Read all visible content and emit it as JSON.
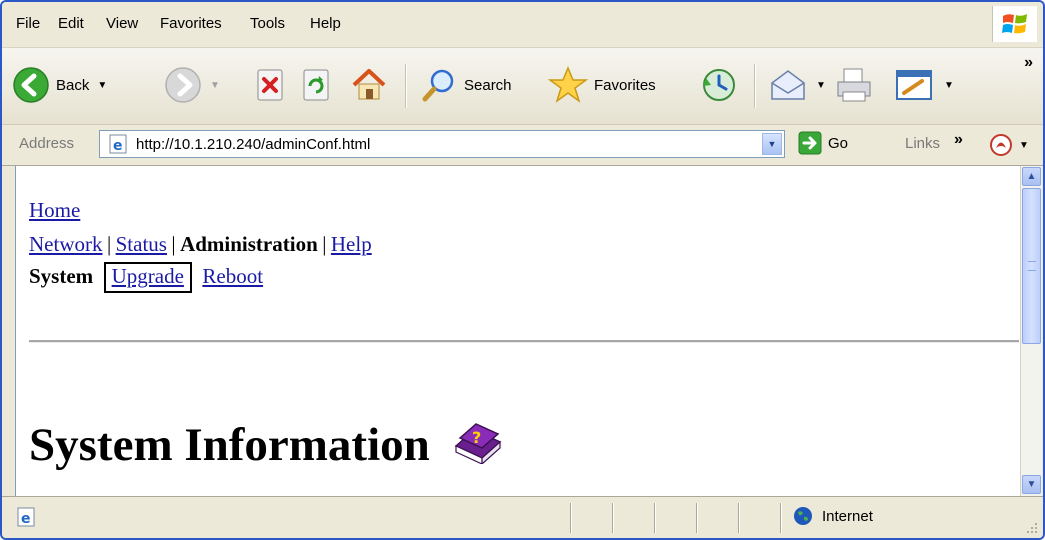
{
  "menu": {
    "items": [
      "File",
      "Edit",
      "View",
      "Favorites",
      "Tools",
      "Help"
    ]
  },
  "toolbar": {
    "back_label": "Back",
    "search_label": "Search",
    "favorites_label": "Favorites",
    "more_chevron": "»"
  },
  "address": {
    "label": "Address",
    "url": "http://10.1.210.240/adminConf.html",
    "go_label": "Go",
    "links_label": "Links",
    "links_chevron": "»"
  },
  "page": {
    "home": "Home",
    "nav": {
      "network": "Network",
      "status": "Status",
      "administration": "Administration",
      "help": "Help",
      "separator": "|"
    },
    "subnav": {
      "system": "System",
      "upgrade": "Upgrade",
      "reboot": "Reboot"
    },
    "heading": "System Information"
  },
  "status": {
    "zone": "Internet"
  },
  "colors": {
    "frame_blue": "#2c57c7",
    "chrome": "#ece9d8",
    "link": "#1a1aa6"
  }
}
